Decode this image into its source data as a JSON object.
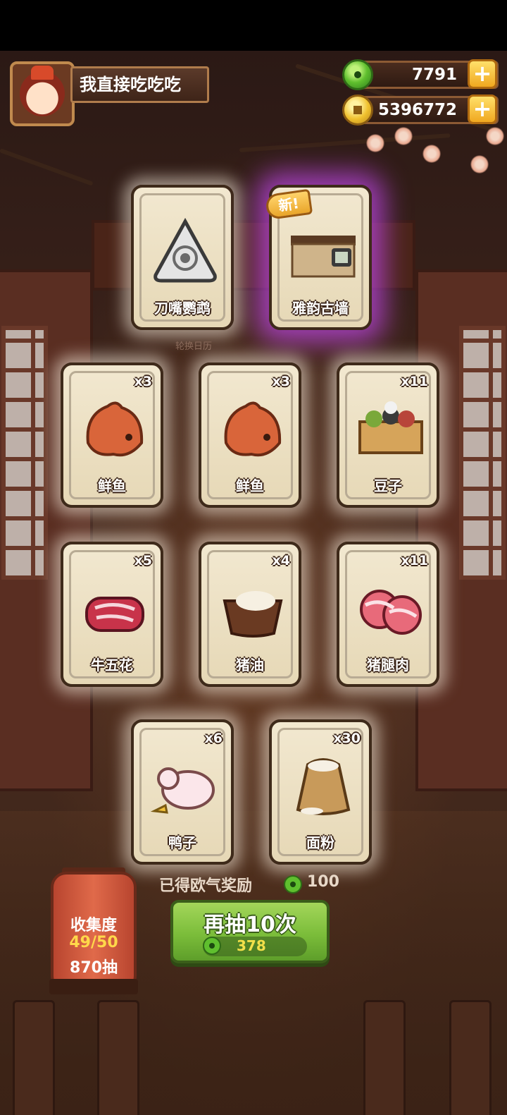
{
  "player": {
    "name": "我直接吃吃吃",
    "jade": "7791",
    "coins": "5396772"
  },
  "featured_cards": [
    {
      "label": "刀嘴鹦鹉",
      "icon": "parrot-token-icon"
    },
    {
      "label": "雅韵古墙",
      "icon": "ancient-wall-icon",
      "badge": "新!"
    }
  ],
  "rotate_label": "轮换日历",
  "item_cards": [
    {
      "label": "鲜鱼",
      "count": "x3",
      "icon": "fish-icon"
    },
    {
      "label": "鲜鱼",
      "count": "x3",
      "icon": "fish-icon"
    },
    {
      "label": "豆子",
      "count": "x11",
      "icon": "beans-box-icon"
    },
    {
      "label": "牛五花",
      "count": "x5",
      "icon": "beef-icon"
    },
    {
      "label": "猪油",
      "count": "x4",
      "icon": "lard-icon"
    },
    {
      "label": "猪腿肉",
      "count": "x11",
      "icon": "pork-icon"
    },
    {
      "label": "鸭子",
      "count": "x6",
      "icon": "duck-icon"
    },
    {
      "label": "面粉",
      "count": "x30",
      "icon": "flour-sack-icon"
    }
  ],
  "collection": {
    "title": "收集度",
    "progress": "49/50",
    "draws": "870抽"
  },
  "reward": {
    "label": "已得欧气奖励",
    "value": "100"
  },
  "draw_button": {
    "label": "再抽10次",
    "cost": "378"
  },
  "colors": {
    "card_glow_purple": "#be46e6",
    "button_green": "#7bbd3a",
    "cost_yellow": "#f2e04a"
  }
}
